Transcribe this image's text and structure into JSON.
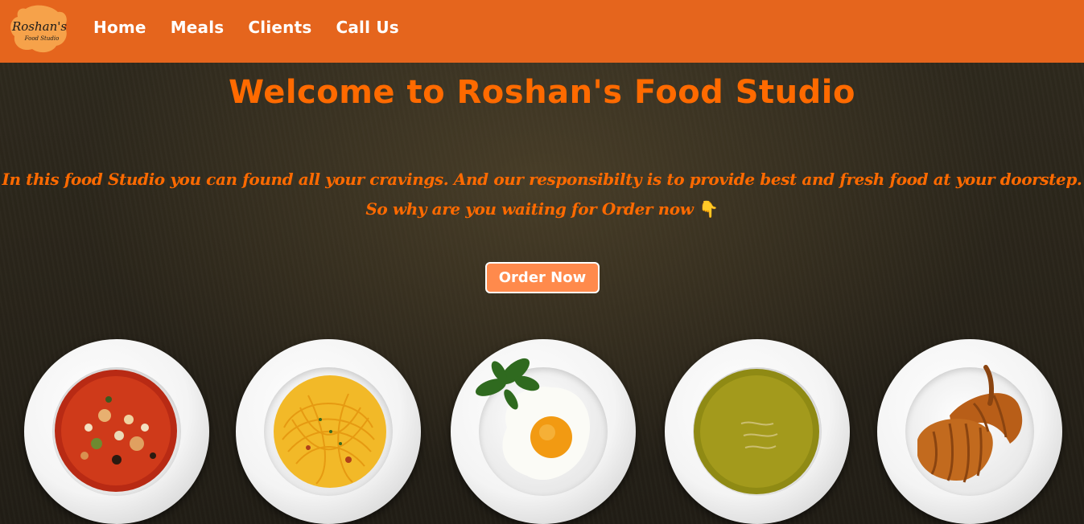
{
  "nav": {
    "logo": {
      "line1": "Roshan's",
      "line2": "Food Studio",
      "color": "#e5651d"
    },
    "links": [
      {
        "label": "Home"
      },
      {
        "label": "Meals"
      },
      {
        "label": "Clients"
      },
      {
        "label": "Call Us"
      }
    ]
  },
  "hero": {
    "title": "Welcome to Roshan's Food Studio",
    "tagline_line1": "In this food Studio you can found all your cravings. And our responsibilty is to provide best and fresh food at your doorstep.",
    "tagline_line2": "So why are you waiting for Order now",
    "tagline_icon": "👇",
    "order_button": "Order Now"
  },
  "dishes": [
    {
      "name": "vegetable-soup-plate",
      "icon": "tomato-soup"
    },
    {
      "name": "spaghetti-plate",
      "icon": "spaghetti"
    },
    {
      "name": "fried-egg-plate",
      "icon": "fried-egg"
    },
    {
      "name": "pea-soup-plate",
      "icon": "green-soup"
    },
    {
      "name": "croissant-plate",
      "icon": "croissant"
    }
  ],
  "colors": {
    "accent": "#e5651d",
    "title": "#ff6a00",
    "button": "#ff8a4c"
  }
}
